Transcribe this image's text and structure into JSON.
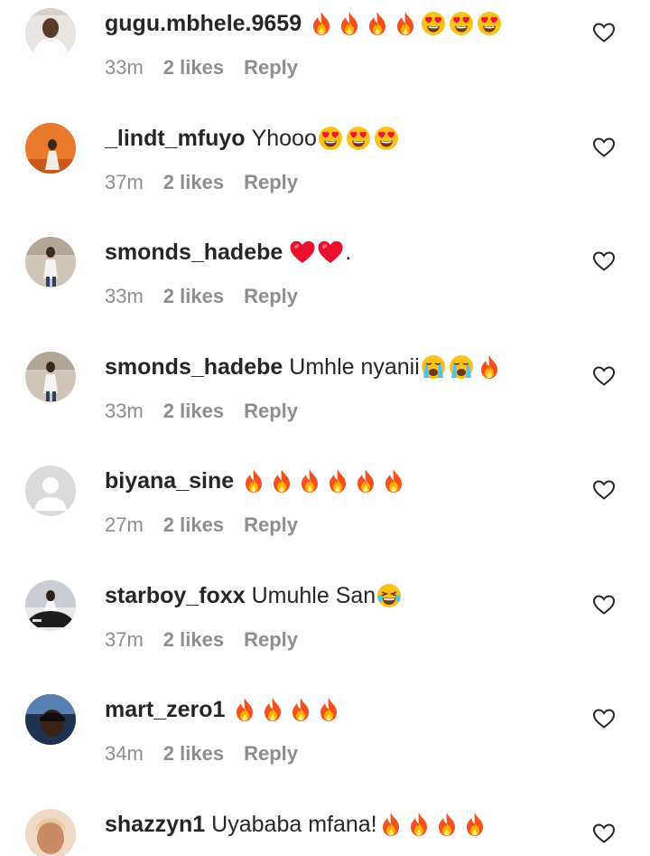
{
  "icons": {
    "like": "heart-outline-icon",
    "fire": "fire-emoji",
    "heart_eyes": "heart-eyes-emoji",
    "red_heart": "red-heart-emoji",
    "crying": "loudly-crying-emoji",
    "laughing": "tears-of-joy-emoji"
  },
  "colors": {
    "username": "#262626",
    "meta": "#8e8e8e"
  },
  "comments": [
    {
      "username": "gugu.mbhele.9659",
      "text": "",
      "emojis": [
        "fire",
        "fire",
        "fire",
        "fire",
        "heart_eyes",
        "heart_eyes",
        "heart_eyes"
      ],
      "time": "33m",
      "likes": "2 likes",
      "reply": "Reply",
      "avatar": "light"
    },
    {
      "username": "_lindt_mfuyo",
      "text": "Yhooo",
      "emojis": [
        "heart_eyes",
        "heart_eyes",
        "heart_eyes"
      ],
      "time": "37m",
      "likes": "2 likes",
      "reply": "Reply",
      "avatar": "orange"
    },
    {
      "username": "smonds_hadebe",
      "text": "",
      "emojis": [
        "red_heart",
        "red_heart"
      ],
      "suffix": ".",
      "time": "33m",
      "likes": "2 likes",
      "reply": "Reply",
      "avatar": "person"
    },
    {
      "username": "smonds_hadebe",
      "text": "Umhle nyanii",
      "emojis": [
        "crying",
        "crying",
        "fire"
      ],
      "time": "33m",
      "likes": "2 likes",
      "reply": "Reply",
      "avatar": "person"
    },
    {
      "username": "biyana_sine",
      "text": "",
      "emojis": [
        "fire",
        "fire",
        "fire",
        "fire",
        "fire",
        "fire"
      ],
      "time": "27m",
      "likes": "2 likes",
      "reply": "Reply",
      "avatar": "default"
    },
    {
      "username": "starboy_foxx",
      "text": "Umuhle San",
      "emojis": [
        "laughing"
      ],
      "time": "37m",
      "likes": "2 likes",
      "reply": "Reply",
      "avatar": "car"
    },
    {
      "username": "mart_zero1",
      "text": "",
      "emojis": [
        "fire",
        "fire",
        "fire",
        "fire"
      ],
      "time": "34m",
      "likes": "2 likes",
      "reply": "Reply",
      "avatar": "dark"
    },
    {
      "username": "shazzyn1",
      "text": "Uyababa mfana!",
      "emojis": [
        "fire",
        "fire",
        "fire",
        "fire"
      ],
      "time": "",
      "likes": "",
      "reply": "",
      "avatar": "woman"
    }
  ]
}
